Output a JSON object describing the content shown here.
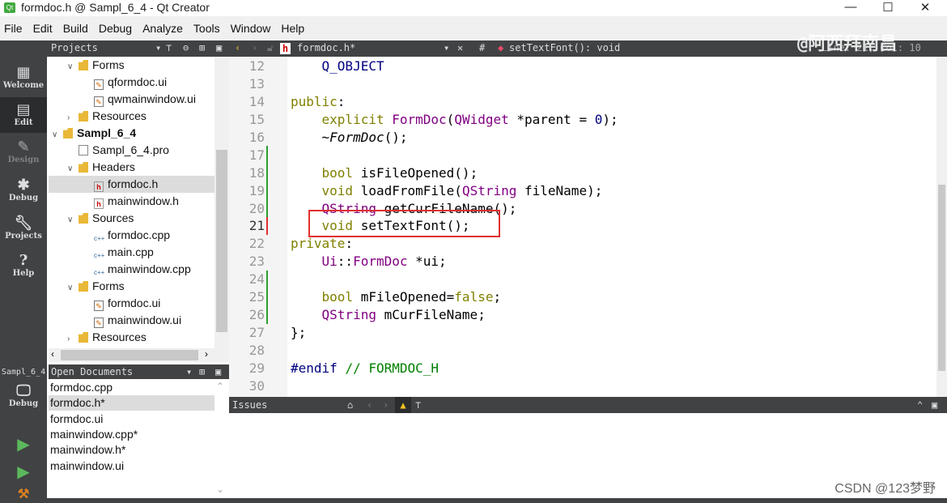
{
  "window": {
    "title": "formdoc.h @ Sampl_6_4 - Qt Creator",
    "app_icon": "Qt"
  },
  "menu": [
    "File",
    "Edit",
    "Build",
    "Debug",
    "Analyze",
    "Tools",
    "Window",
    "Help"
  ],
  "toolbar": {
    "projects_label": "Projects",
    "file_name": "formdoc.h*",
    "symbol": "setTextFont(): void",
    "hash": "#",
    "line_col": "Line: 21, Col: 10"
  },
  "modes": [
    {
      "label": "Welcome",
      "icon": "grid-icon"
    },
    {
      "label": "Edit",
      "icon": "edit-icon"
    },
    {
      "label": "Design",
      "icon": "pencil-icon"
    },
    {
      "label": "Debug",
      "icon": "bug-icon"
    },
    {
      "label": "Projects",
      "icon": "wrench-icon"
    },
    {
      "label": "Help",
      "icon": "help-icon"
    }
  ],
  "kit": {
    "project": "Sampl_6_4",
    "mode": "Debug"
  },
  "tree": [
    {
      "label": "Forms",
      "type": "folder",
      "level": 1,
      "open": true
    },
    {
      "label": "qformdoc.ui",
      "type": "ui",
      "level": 2
    },
    {
      "label": "qwmainwindow.ui",
      "type": "ui",
      "level": 2
    },
    {
      "label": "Resources",
      "type": "folder",
      "level": 1,
      "open": false
    },
    {
      "label": "Sampl_6_4",
      "type": "project",
      "level": 0,
      "open": true,
      "bold": true
    },
    {
      "label": "Sampl_6_4.pro",
      "type": "pro",
      "level": 1
    },
    {
      "label": "Headers",
      "type": "folder",
      "level": 1,
      "open": true
    },
    {
      "label": "formdoc.h",
      "type": "h",
      "level": 2,
      "selected": true
    },
    {
      "label": "mainwindow.h",
      "type": "h",
      "level": 2
    },
    {
      "label": "Sources",
      "type": "folder",
      "level": 1,
      "open": true
    },
    {
      "label": "formdoc.cpp",
      "type": "cpp",
      "level": 2
    },
    {
      "label": "main.cpp",
      "type": "cpp",
      "level": 2
    },
    {
      "label": "mainwindow.cpp",
      "type": "cpp",
      "level": 2
    },
    {
      "label": "Forms",
      "type": "folder",
      "level": 1,
      "open": true
    },
    {
      "label": "formdoc.ui",
      "type": "ui",
      "level": 2
    },
    {
      "label": "mainwindow.ui",
      "type": "ui",
      "level": 2
    },
    {
      "label": "Resources",
      "type": "folder",
      "level": 1,
      "open": false
    }
  ],
  "open_documents": {
    "title": "Open Documents",
    "items": [
      "formdoc.cpp",
      "formdoc.h*",
      "formdoc.ui",
      "mainwindow.cpp*",
      "mainwindow.h*",
      "mainwindow.ui"
    ],
    "selected": 1
  },
  "editor": {
    "current_line": 21,
    "lines": [
      {
        "n": "12",
        "t": [
          [
            "mc",
            "    Q_OBJECT"
          ]
        ]
      },
      {
        "n": "13",
        "t": []
      },
      {
        "n": "14",
        "t": [
          [
            "kw",
            "public"
          ],
          [
            "",
            ":"
          ]
        ]
      },
      {
        "n": "15",
        "t": [
          [
            "kw",
            "    explicit "
          ],
          [
            "ty",
            "FormDoc"
          ],
          [
            "",
            "("
          ],
          [
            "ty",
            "QWidget"
          ],
          [
            "",
            " *parent = "
          ],
          [
            "num",
            "0"
          ],
          [
            "",
            ");"
          ]
        ]
      },
      {
        "n": "16",
        "t": [
          [
            "",
            "    ~"
          ],
          [
            "it",
            "FormDoc"
          ],
          [
            "",
            "();"
          ]
        ]
      },
      {
        "n": "17",
        "t": []
      },
      {
        "n": "18",
        "t": [
          [
            "kw",
            "    bool "
          ],
          [
            "",
            "isFileOpened();"
          ]
        ]
      },
      {
        "n": "19",
        "t": [
          [
            "kw",
            "    void "
          ],
          [
            "",
            "loadFromFile("
          ],
          [
            "ty",
            "QString"
          ],
          [
            "",
            " fileName);"
          ]
        ]
      },
      {
        "n": "20",
        "t": [
          [
            "ty",
            "    QString "
          ],
          [
            "",
            "getCurFileName();"
          ]
        ]
      },
      {
        "n": "21",
        "t": [
          [
            "kw",
            "    void "
          ],
          [
            "",
            "setTextFont();"
          ]
        ]
      },
      {
        "n": "22",
        "t": [
          [
            "kw",
            "private"
          ],
          [
            "",
            ":"
          ]
        ]
      },
      {
        "n": "23",
        "t": [
          [
            "ty",
            "    Ui"
          ],
          [
            "",
            "::"
          ],
          [
            "ty",
            "FormDoc"
          ],
          [
            "",
            " *ui;"
          ]
        ]
      },
      {
        "n": "24",
        "t": []
      },
      {
        "n": "25",
        "t": [
          [
            "kw",
            "    bool "
          ],
          [
            "",
            "mFileOpened="
          ],
          [
            "kw",
            "false"
          ],
          [
            "",
            ";"
          ]
        ]
      },
      {
        "n": "26",
        "t": [
          [
            "ty",
            "    QString "
          ],
          [
            "",
            "mCurFileName;"
          ]
        ]
      },
      {
        "n": "27",
        "t": [
          [
            "",
            "};"
          ]
        ]
      },
      {
        "n": "28",
        "t": []
      },
      {
        "n": "29",
        "t": [
          [
            "mc",
            "#endif "
          ],
          [
            "cm",
            "// FORMDOC_H"
          ]
        ]
      },
      {
        "n": "30",
        "t": []
      }
    ]
  },
  "issues": {
    "title": "Issues"
  },
  "watermarks": {
    "top": "@阿西拜南昌",
    "bottom": "CSDN @123梦野"
  },
  "colors": {
    "dark_panel": "#404244",
    "keyword": "#808000",
    "type": "#800080",
    "macro": "#000080",
    "comment": "#008000",
    "highlight_box": "#e03030"
  }
}
